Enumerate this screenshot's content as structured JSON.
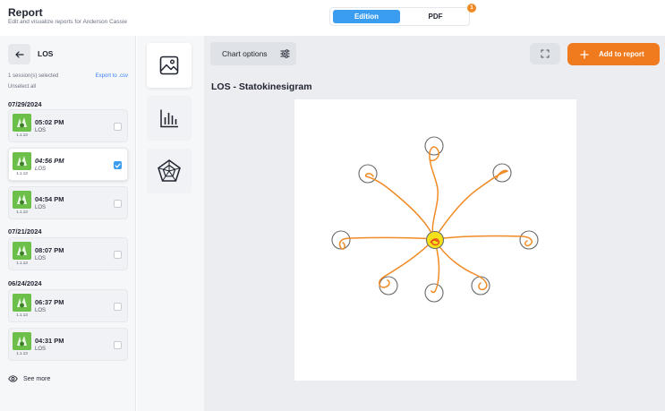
{
  "header": {
    "title": "Report",
    "subtitle": "Edit and visualize reports for Anderson Cassie",
    "tabs": [
      {
        "label": "Edition",
        "active": true
      },
      {
        "label": "PDF",
        "active": false
      }
    ],
    "pdf_badge": "1"
  },
  "sidebar": {
    "back_icon": "arrow-left-icon",
    "title": "LOS",
    "sessions_selected": "1 session(s) selected",
    "export_label": "Export to .csv",
    "unselect_label": "Unselect all",
    "groups": [
      {
        "date": "07/29/2024",
        "sessions": [
          {
            "time": "05:02 PM",
            "type": "LOS",
            "version": "1.1.13",
            "checked": false
          },
          {
            "time": "04:56 PM",
            "type": "LOS",
            "version": "1.1.13",
            "checked": true
          },
          {
            "time": "04:54 PM",
            "type": "LOS",
            "version": "1.1.13",
            "checked": false
          }
        ]
      },
      {
        "date": "07/21/2024",
        "sessions": [
          {
            "time": "08:07 PM",
            "type": "LOS",
            "version": "1.1.13",
            "checked": false
          }
        ]
      },
      {
        "date": "06/24/2024",
        "sessions": [
          {
            "time": "06:37 PM",
            "type": "LOS",
            "version": "1.1.13",
            "checked": false
          },
          {
            "time": "04:31 PM",
            "type": "LOS",
            "version": "1.1.13",
            "checked": false
          }
        ]
      }
    ],
    "see_more": "See more"
  },
  "tools": [
    {
      "icon": "image-icon",
      "active": true
    },
    {
      "icon": "bar-chart-icon",
      "active": false
    },
    {
      "icon": "radar-chart-icon",
      "active": false
    }
  ],
  "main": {
    "chart_options_label": "Chart options",
    "add_to_report_label": "Add to report",
    "chart_title": "LOS - Statokinesigram"
  },
  "colors": {
    "accent_blue": "#3b9df0",
    "accent_orange": "#f07a1e",
    "trace_orange": "#f08a24",
    "center_yellow": "#f5e11a"
  }
}
